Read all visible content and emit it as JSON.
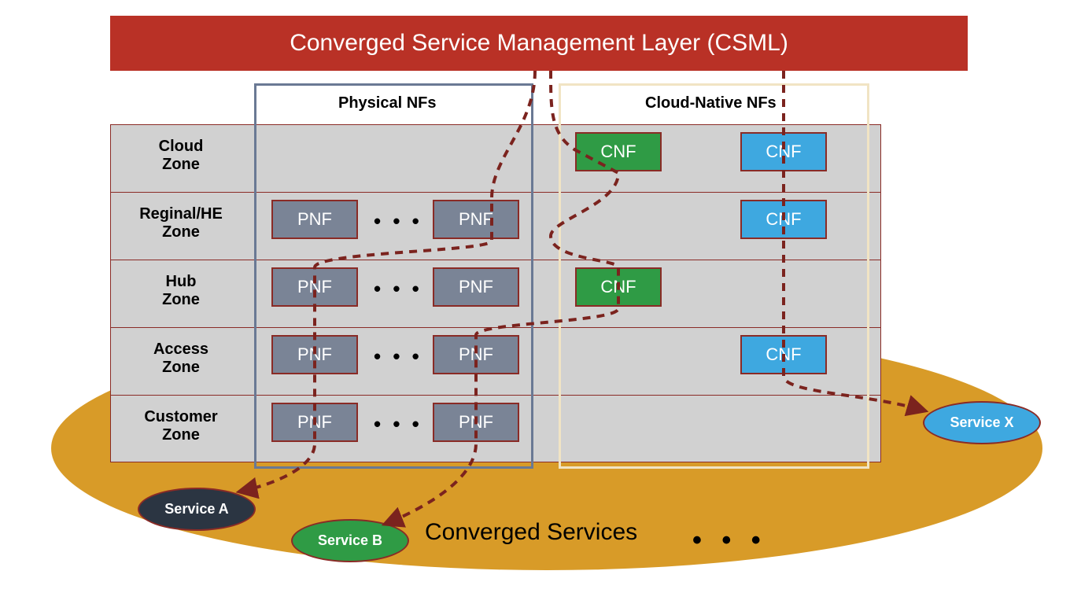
{
  "header": {
    "title": "Converged Service Management Layer (CSML)"
  },
  "columns": {
    "physical": "Physical NFs",
    "cloud_native": "Cloud-Native NFs"
  },
  "zones": {
    "cloud": "Cloud\nZone",
    "regional": "Reginal/HE\nZone",
    "hub": "Hub\nZone",
    "access": "Access\nZone",
    "customer": "Customer\nZone"
  },
  "nf": {
    "pnf": "PNF",
    "cnf": "CNF"
  },
  "ellipsis": "• • •",
  "services": {
    "a": "Service A",
    "b": "Service B",
    "x": "Service X",
    "label": "Converged Services"
  },
  "colors": {
    "csml_bg": "#b93126",
    "grid_bg": "#d1d1d1",
    "ellipse_bg": "#d89b28",
    "pnf_bg": "#7a8496",
    "cnf_green": "#2f9b45",
    "cnf_blue": "#3ea8e0",
    "svc_dark": "#2b3542",
    "physical_border": "#6a7994",
    "cloud_native_border": "#f1e4c4",
    "dash": "#7b231e"
  }
}
